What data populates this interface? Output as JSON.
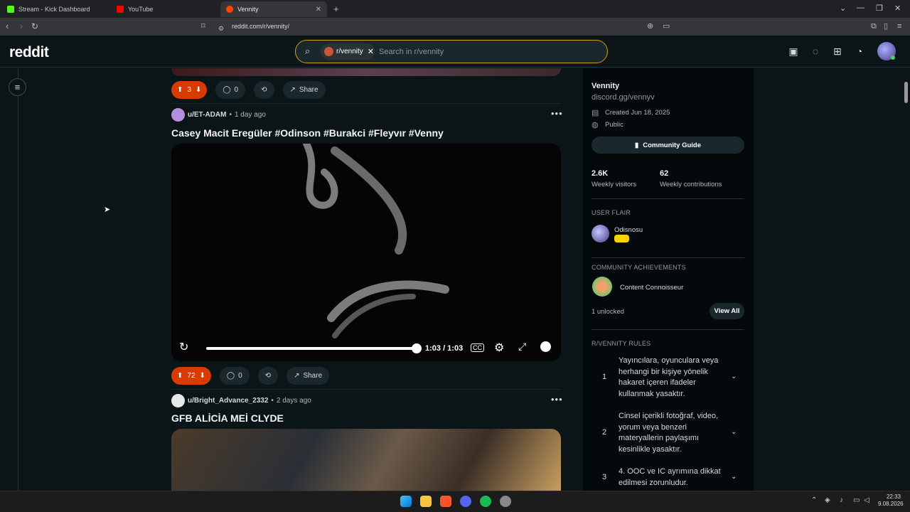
{
  "browser": {
    "tabs": [
      {
        "label": "Stream - Kick Dashboard",
        "color": "#53fc18"
      },
      {
        "label": "YouTube",
        "color": "#ff0000"
      },
      {
        "label": "Vennity",
        "color": "#ff4500"
      }
    ],
    "url": "reddit.com/r/vennity/"
  },
  "header": {
    "logo": "reddit",
    "search_chip": "r/vennity",
    "search_placeholder": "Search in r/vennity"
  },
  "feed": {
    "post0": {
      "votes": "3",
      "comments": "0",
      "share": "Share"
    },
    "post1": {
      "user": "u/ET-ADAM",
      "time": "1 day ago",
      "title": "Casey Macit Eregüler #Odinson #Burakci #Fleyvır #Venny",
      "video_time": "1:03 / 1:03",
      "video_progress": 1.0,
      "votes": "72",
      "comments": "0",
      "share": "Share"
    },
    "post2": {
      "user": "u/Bright_Advance_2332",
      "time": "2 days ago",
      "title": "GFB ALİCİA MEİ CLYDE"
    }
  },
  "sidebar": {
    "name": "Vennity",
    "link": "discord.gg/vennyv",
    "created": "Created Jun 18, 2025",
    "visibility": "Public",
    "guide_button": "Community Guide",
    "stats": [
      {
        "value": "2.6K",
        "label": "Weekly visitors"
      },
      {
        "value": "62",
        "label": "Weekly contributions"
      }
    ],
    "user_flair_heading": "USER FLAIR",
    "flair_name": "Odisnosu",
    "achievements_heading": "COMMUNITY ACHIEVEMENTS",
    "achievement": "Content Connoisseur",
    "unlocked": "1 unlocked",
    "view_all": "View All",
    "rules_heading": "R/VENNITY RULES",
    "rules": [
      {
        "num": "1",
        "text": "Yayıncılara, oyunculara veya herhangi bir kişiye yönelik hakaret içeren ifadeler kullanmak yasaktır."
      },
      {
        "num": "2",
        "text": "Cinsel içerikli fotoğraf, video, yorum veya benzeri materyallerin paylaşımı kesinlikle yasaktır."
      },
      {
        "num": "3",
        "text": "4. OOC ve IC ayrımına dikkat edilmesi zorunludur."
      }
    ]
  },
  "taskbar": {
    "time": "22:33",
    "date": "9.08.2026"
  }
}
